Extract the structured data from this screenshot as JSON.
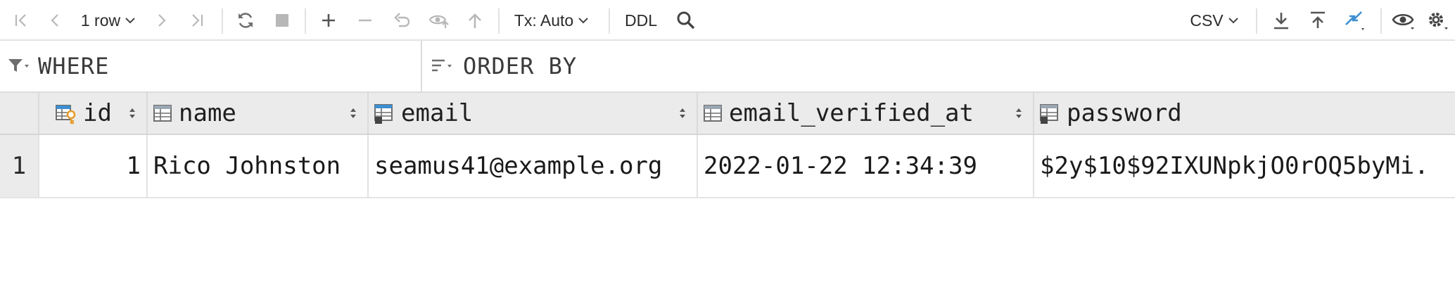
{
  "toolbar": {
    "rows_label": "1 row",
    "tx_label": "Tx: Auto",
    "ddl_label": "DDL",
    "export_format": "CSV"
  },
  "filters": {
    "where_label": "WHERE",
    "order_label": "ORDER BY"
  },
  "table": {
    "columns": [
      {
        "name": "id"
      },
      {
        "name": "name"
      },
      {
        "name": "email"
      },
      {
        "name": "email_verified_at"
      },
      {
        "name": "password"
      }
    ],
    "rows": [
      {
        "row_number": "1",
        "cells": [
          "1",
          "Rico Johnston",
          "seamus41@example.org",
          "2022-01-22 12:34:39",
          "$2y$10$92IXUNpkjO0rOQ5byMi."
        ]
      }
    ]
  },
  "colors": {
    "accent_blue": "#3d8fd1",
    "key_orange": "#e59d2b",
    "icon_gray": "#6e6e6e",
    "disabled_gray": "#b8b8b8"
  }
}
